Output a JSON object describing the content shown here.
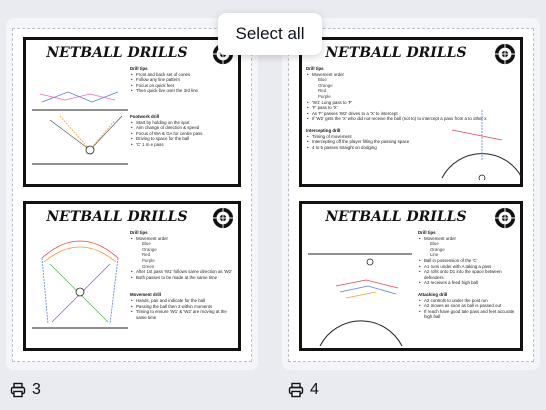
{
  "toolbar": {
    "select_all_label": "Select all"
  },
  "pages": [
    {
      "page_number": "3",
      "cards": [
        {
          "title": "NETBALL DRILLS",
          "sections": [
            {
              "heading": "Drill tips",
              "items": [
                "Front and back set of cones",
                "Follow any line pattern",
                "Focus on quick feet",
                "Then quick live over the 3rd line"
              ]
            },
            {
              "heading": "Footwork drill",
              "items": [
                "Start by holding on the spot",
                "Aim change of direction & speed",
                "Focus of WA & GA for centre pass",
                "Driving to space for the ball",
                "'C' 1 m e pass"
              ]
            }
          ]
        },
        {
          "title": "NETBALL DRILLS",
          "sections": [
            {
              "heading": "Drill tips",
              "items": [
                "Movement order"
              ],
              "subs": [
                "Blue",
                "Orange",
                "Red",
                "Purple",
                "Green"
              ]
            },
            {
              "heading": "",
              "items": [
                "After 1st pass 'W1' follows same direction as 'W2'",
                "Both passes to be made at the same time"
              ]
            },
            {
              "heading": "Movement drill",
              "items": [
                "Hands, pair and indicate for the ball",
                "Passing the ball then 2 within moments",
                "Timing to ensure 'W1' & 'W2' are moving at the same time"
              ]
            }
          ]
        }
      ]
    },
    {
      "page_number": "4",
      "cards": [
        {
          "title": "NETBALL DRILLS",
          "sections": [
            {
              "heading": "Drill tips",
              "items": [
                "Movement order"
              ],
              "subs": [
                "Blue",
                "Orange",
                "Red",
                "Purple"
              ]
            },
            {
              "heading": "",
              "items": [
                "'W1' Long pass to 'F'",
                "'F' pass to 'X'",
                "As 'F' passes 'W2' drives to a 'X' to intercept",
                "If 'W2' gets the 'X' who did not receive the ball (not to) to intercept a pass from a to other x"
              ]
            },
            {
              "heading": "Intercepting drill",
              "items": [
                "Timing of movement",
                "Intercepting off the player filling the passing space",
                "4 to 5 passes straight on dodging"
              ]
            }
          ]
        },
        {
          "title": "NETBALL DRILLS",
          "sections": [
            {
              "heading": "Drill tips",
              "items": [
                "Movement order"
              ],
              "subs": [
                "Blue",
                "Orange",
                "Line"
              ]
            },
            {
              "heading": "",
              "items": [
                "Ball in possession of the 'C'",
                "A1 runs under with A taking a pass",
                "A2 rolls onto D1 into the space between defenders",
                "A2 receives a feed high ball"
              ]
            },
            {
              "heading": "Attacking drill",
              "items": [
                "A2 controls to under the post run",
                "A2 moves as soon as ball is passed out",
                "If reach have good tale pass and feet accurate high ball"
              ]
            }
          ]
        }
      ]
    }
  ],
  "colors": {
    "blue": "#5b7fd6",
    "orange": "#f0a030",
    "red": "#e24848",
    "purple": "#a05ad0",
    "green": "#5ab35a",
    "pink": "#e56fb8"
  }
}
